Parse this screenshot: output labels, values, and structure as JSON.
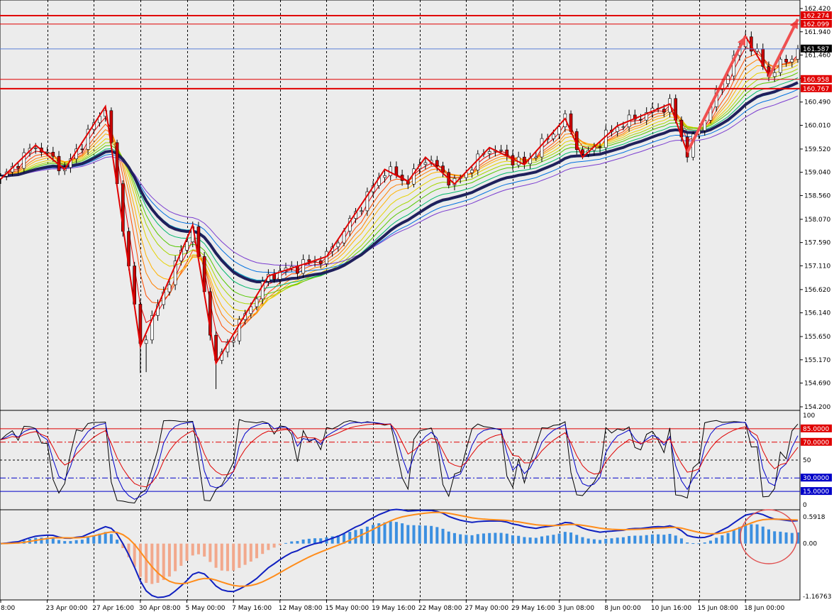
{
  "chart_data": [
    {
      "type": "candlestick",
      "panel": "price",
      "colors": {
        "background": "#ececec",
        "candle_up": "#ffffff",
        "candle_down": "#cc0000",
        "slow_ma": "#20205c",
        "zigzag": "#e00000",
        "arrows": "#f05050",
        "current_line": "#5a7fd6"
      },
      "ylim": [
        154.2,
        162.42
      ],
      "y_ticks": [
        "162.420",
        "161.940",
        "161.460",
        "160.980",
        "160.490",
        "160.010",
        "159.520",
        "159.040",
        "158.560",
        "158.070",
        "157.590",
        "157.110",
        "156.620",
        "156.140",
        "155.650",
        "155.170",
        "154.690",
        "154.200"
      ],
      "current_price": {
        "label": "161.587",
        "value": 161.587
      },
      "levels": [
        {
          "label": "162.274",
          "value": 162.274
        },
        {
          "label": "162.099",
          "value": 162.099
        },
        {
          "label": "160.958",
          "value": 160.958
        },
        {
          "label": "160.767",
          "value": 160.767
        }
      ],
      "zigzag": [
        [
          0,
          158.9
        ],
        [
          6,
          159.6
        ],
        [
          11,
          159.1
        ],
        [
          18,
          160.4
        ],
        [
          24,
          155.45
        ],
        [
          33,
          157.95
        ],
        [
          37,
          155.1
        ],
        [
          46,
          156.9
        ],
        [
          56,
          157.3
        ],
        [
          66,
          159.1
        ],
        [
          70,
          158.85
        ],
        [
          73,
          159.35
        ],
        [
          78,
          158.8
        ],
        [
          84,
          159.55
        ],
        [
          90,
          159.2
        ],
        [
          97,
          160.15
        ],
        [
          100,
          159.35
        ],
        [
          106,
          160.0
        ],
        [
          115,
          160.45
        ],
        [
          118,
          159.45
        ],
        [
          128,
          161.85
        ],
        [
          132,
          161.05
        ]
      ],
      "forecast_arrows": [
        {
          "from": [
            118,
            159.45
          ],
          "to": [
            128,
            161.85
          ]
        },
        {
          "from": [
            132,
            161.0
          ],
          "to": [
            137,
            162.2
          ]
        }
      ]
    },
    {
      "type": "line",
      "panel": "oscillator",
      "ylim": [
        0,
        100
      ],
      "y_ticks": [
        "100",
        "50",
        "0"
      ],
      "levels": [
        {
          "label": "85.0000",
          "value": 85,
          "color": "#e00000",
          "style": "solid"
        },
        {
          "label": "70.0000",
          "value": 70,
          "color": "#e00000",
          "style": "dashdot"
        },
        {
          "label": "30.0000",
          "value": 30,
          "color": "#0000c8",
          "style": "dashdot"
        },
        {
          "label": "15.0000",
          "value": 15,
          "color": "#0000c8",
          "style": "solid"
        }
      ],
      "series_colors": [
        "#000000",
        "#0000c8",
        "#e00000"
      ]
    },
    {
      "type": "histogram",
      "panel": "macd",
      "ylim": [
        -1.16763,
        0.5918
      ],
      "y_ticks": [
        "0.5918",
        "0.00",
        "-1.16763"
      ],
      "colors": {
        "positive": "#3b8fe0",
        "negative": "#f2a88c",
        "main": "#1020c0",
        "signal": "#ff8c1a",
        "highlight": "#e05050"
      }
    }
  ],
  "x_ticks": [
    {
      "label": "8:00",
      "i": 0
    },
    {
      "label": "23 Apr 00:00",
      "i": 8
    },
    {
      "label": "27 Apr 16:00",
      "i": 16
    },
    {
      "label": "30 Apr 08:00",
      "i": 24
    },
    {
      "label": "5 May 00:00",
      "i": 32
    },
    {
      "label": "7 May 16:00",
      "i": 40
    },
    {
      "label": "12 May 08:00",
      "i": 48
    },
    {
      "label": "15 May 00:00",
      "i": 56
    },
    {
      "label": "19 May 16:00",
      "i": 64
    },
    {
      "label": "22 May 08:00",
      "i": 72
    },
    {
      "label": "27 May 00:00",
      "i": 80
    },
    {
      "label": "29 May 16:00",
      "i": 88
    },
    {
      "label": "3 Jun 08:00",
      "i": 96
    },
    {
      "label": "8 Jun 00:00",
      "i": 104
    },
    {
      "label": "10 Jun 16:00",
      "i": 112
    },
    {
      "label": "15 Jun 08:00",
      "i": 120
    },
    {
      "label": "18 Jun 00:00",
      "i": 128
    }
  ],
  "bar_count": 138
}
